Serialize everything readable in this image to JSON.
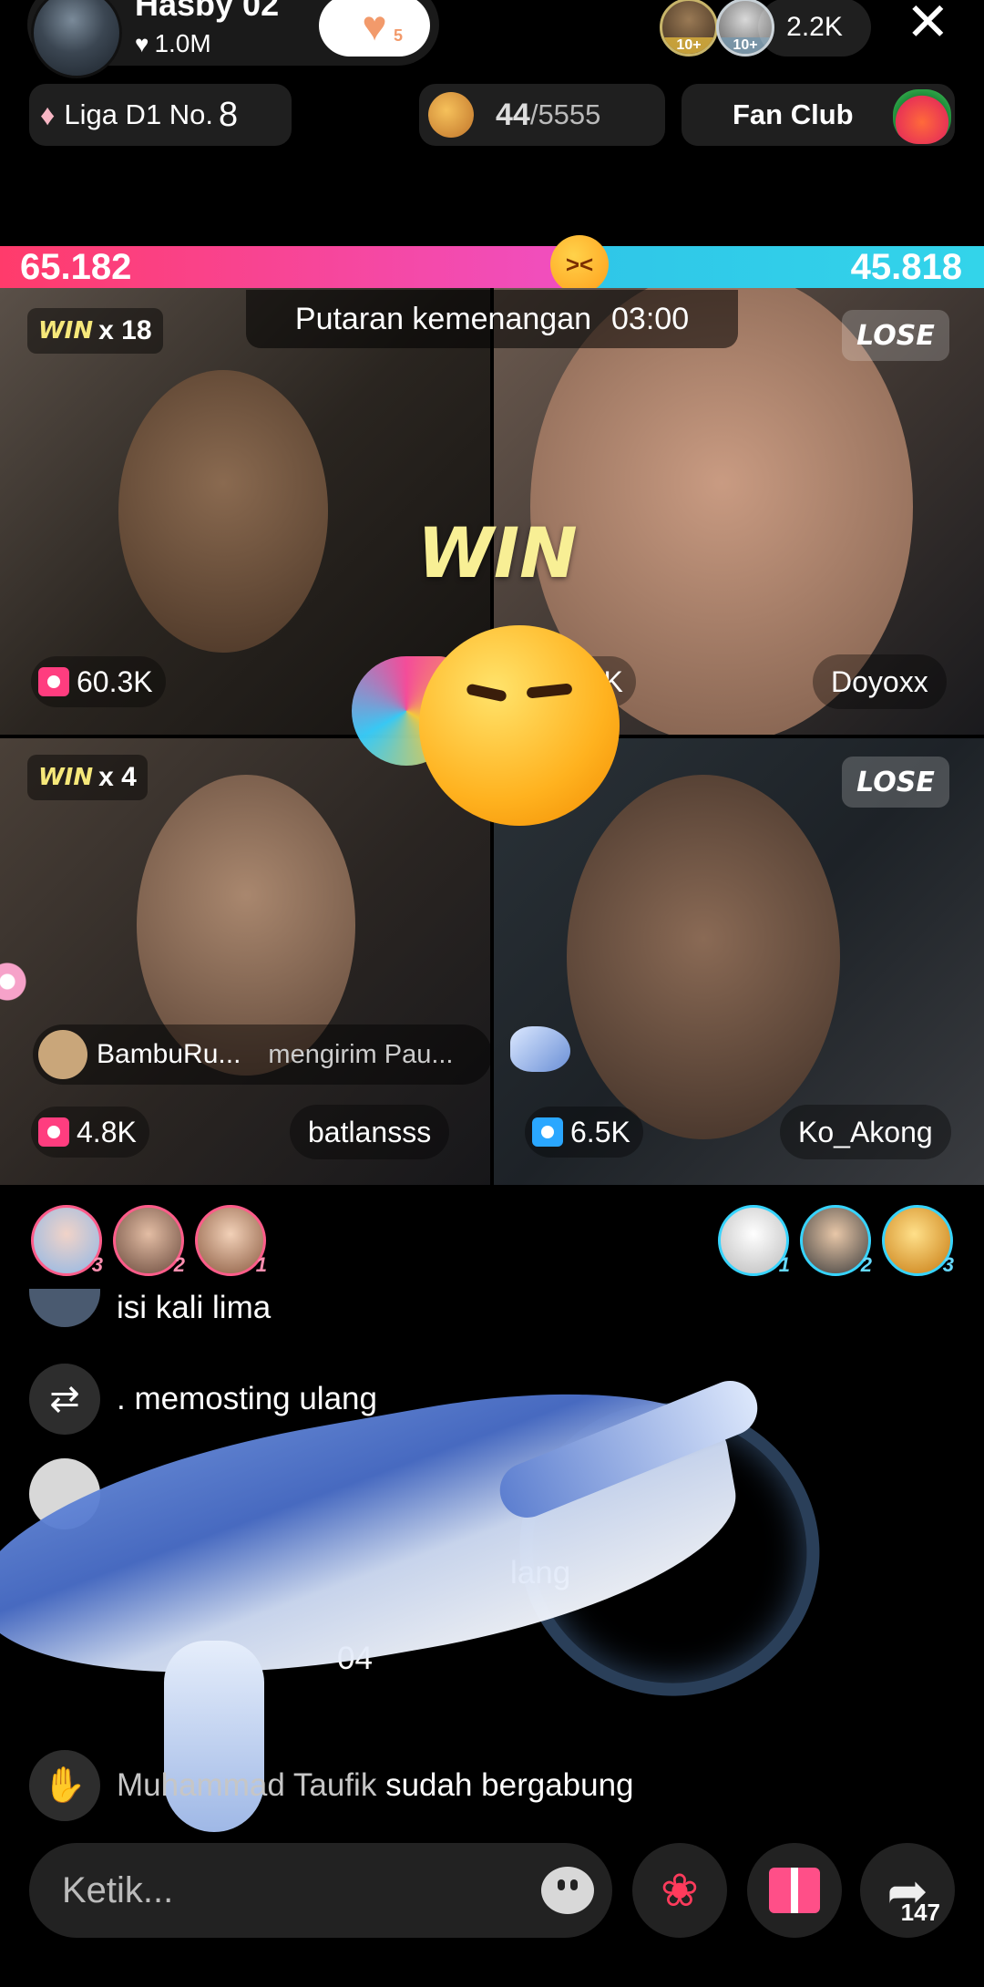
{
  "header": {
    "host_name": "Hasby 02",
    "host_likes": "1.0M",
    "follow_count": "5",
    "viewer_tags": [
      "10+",
      "10+"
    ],
    "viewer_count": "2.2K",
    "league_label": "Liga D1 No.",
    "league_number": "8",
    "team_progress_current": "44",
    "team_progress_total": "/5555",
    "fan_club_label": "Fan Club"
  },
  "battle": {
    "score_left": "65.182",
    "score_right": "45.818",
    "score_left_fraction": 0.587,
    "round_label": "Putaran kemenangan",
    "round_timer": "03:00",
    "center_label": "WIN",
    "players": [
      {
        "name": "",
        "result": "WIN",
        "multiplier": "x 18",
        "gifts": "60.3K",
        "gift_color": "pink"
      },
      {
        "name": "Doyoxx",
        "result": "LOSE",
        "multiplier": "",
        "gifts": "2.3K",
        "gift_color": "blue"
      },
      {
        "name": "batlansss",
        "result": "WIN",
        "multiplier": "x 4",
        "gifts": "4.8K",
        "gift_color": "pink"
      },
      {
        "name": "Ko_Akong",
        "result": "LOSE",
        "multiplier": "",
        "gifts": "6.5K",
        "gift_color": "blue"
      }
    ],
    "gift_message": {
      "user": "BambuRu...",
      "text": "mengirim Pau..."
    }
  },
  "gifters_left": [
    "3",
    "2",
    "1"
  ],
  "gifters_right": [
    "1",
    "2",
    "3"
  ],
  "chat": [
    {
      "user": "",
      "text": "isi kali lima"
    },
    {
      "user": "",
      "text": ". memosting ulang"
    },
    {
      "user": "",
      "text": "lang"
    },
    {
      "user": "",
      "text": "04"
    },
    {
      "user": "Muhammad Taufik",
      "text": "sudah bergabung"
    }
  ],
  "bottom": {
    "input_placeholder": "Ketik...",
    "share_count": "147"
  },
  "colors": {
    "score_left": "#ff3b6b",
    "score_right": "#2fc6e8",
    "win_text": "#f6e87a"
  }
}
